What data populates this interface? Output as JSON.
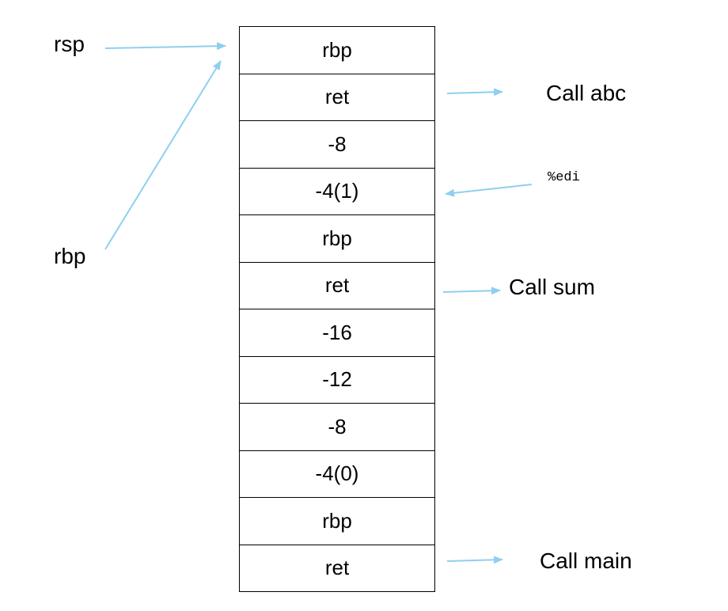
{
  "stack_cells": [
    "rbp",
    "ret",
    "-8",
    "-4(1)",
    "rbp",
    "ret",
    "-16",
    "-12",
    "-8",
    "-4(0)",
    "rbp",
    "ret"
  ],
  "labels": {
    "rsp": "rsp",
    "rbp": "rbp",
    "call_abc": "Call abc",
    "edi": "%edi",
    "call_sum": "Call sum",
    "call_main": "Call main"
  },
  "arrow_color": "#8fcff0"
}
